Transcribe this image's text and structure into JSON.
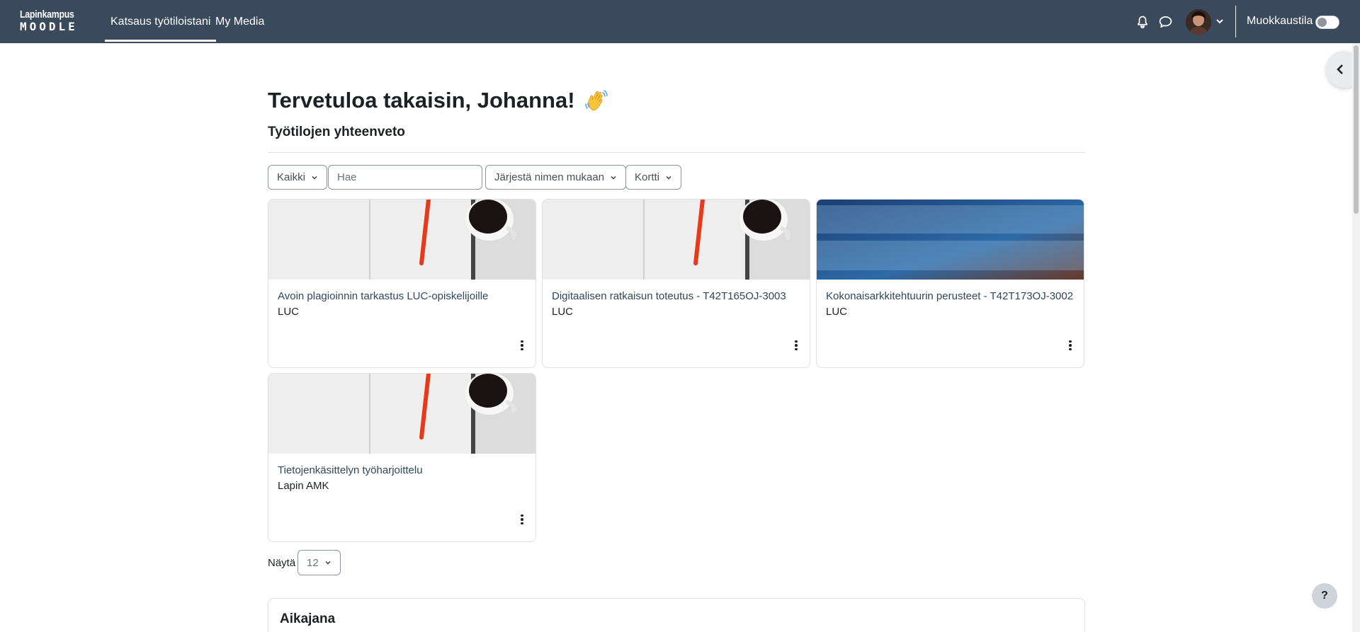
{
  "navbar": {
    "logo_top": "Lapinkampus",
    "logo_bottom": "MOODLE",
    "links": [
      {
        "label": "Katsaus työtiloistani",
        "active": true
      },
      {
        "label": "My Media",
        "active": false
      }
    ],
    "icons": [
      "bell-icon",
      "chat-icon"
    ],
    "edit_mode_label": "Muokkaustila",
    "edit_mode_on": false,
    "bg_color": "#3a4a5c"
  },
  "main": {
    "welcome": "Tervetuloa takaisin, Johanna!",
    "wave_emoji": "👋",
    "section_title": "Työtilojen yhteenveto",
    "filters": {
      "grouping": "Kaikki",
      "search_placeholder": "Hae",
      "sort": "Järjestä nimen mukaan",
      "view": "Kortti"
    },
    "courses": [
      {
        "title": "Avoin plagioinnin tarkastus LUC-opiskelijoille",
        "org": "LUC",
        "image": "notebook-pen-coffee"
      },
      {
        "title": "Digitaalisen ratkaisun toteutus - T42T165OJ-3003",
        "org": "LUC",
        "image": "notebook-pen-coffee"
      },
      {
        "title": "Kokonaisarkkitehtuurin perusteet - T42T173OJ-3002",
        "org": "LUC",
        "image": "enterprise-architecture"
      },
      {
        "title": "Tietojenkäsittelyn työharjoittelu",
        "org": "Lapin AMK",
        "image": "notebook-pen-coffee"
      }
    ],
    "pagination": {
      "show_label": "Näytä",
      "per_page": "12"
    },
    "timeline_title": "Aikajana"
  },
  "help_label": "?"
}
